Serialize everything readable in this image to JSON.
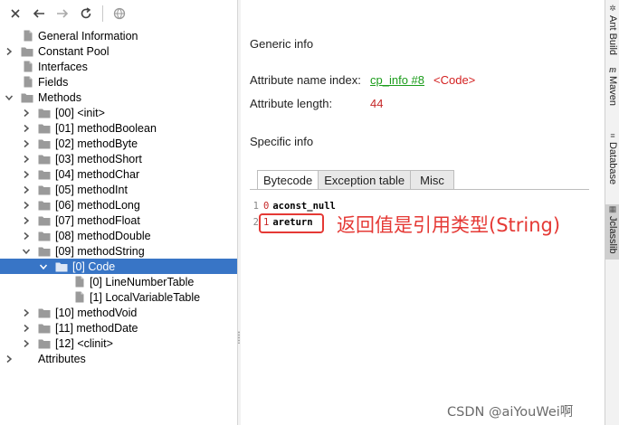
{
  "toolbar": {
    "buttons": [
      {
        "name": "close-icon",
        "glyph": "✕"
      },
      {
        "name": "back-icon",
        "glyph": "←"
      },
      {
        "name": "forward-icon",
        "glyph": "→"
      },
      {
        "name": "refresh-icon",
        "glyph": "↻"
      },
      {
        "name": "browser-icon",
        "glyph": "◍"
      }
    ]
  },
  "tree": {
    "items": [
      {
        "label": "General Information",
        "type": "file"
      },
      {
        "label": "Constant Pool",
        "type": "folder",
        "state": "collapsed"
      },
      {
        "label": "Interfaces",
        "type": "file"
      },
      {
        "label": "Fields",
        "type": "file"
      },
      {
        "label": "Methods",
        "type": "folder",
        "state": "expanded"
      },
      {
        "label": "[00] <init>",
        "type": "folder",
        "state": "collapsed"
      },
      {
        "label": "[01] methodBoolean",
        "type": "folder",
        "state": "collapsed"
      },
      {
        "label": "[02] methodByte",
        "type": "folder",
        "state": "collapsed"
      },
      {
        "label": "[03] methodShort",
        "type": "folder",
        "state": "collapsed"
      },
      {
        "label": "[04] methodChar",
        "type": "folder",
        "state": "collapsed"
      },
      {
        "label": "[05] methodInt",
        "type": "folder",
        "state": "collapsed"
      },
      {
        "label": "[06] methodLong",
        "type": "folder",
        "state": "collapsed"
      },
      {
        "label": "[07] methodFloat",
        "type": "folder",
        "state": "collapsed"
      },
      {
        "label": "[08] methodDouble",
        "type": "folder",
        "state": "collapsed"
      },
      {
        "label": "[09] methodString",
        "type": "folder",
        "state": "expanded"
      },
      {
        "label": "[0] Code",
        "type": "folder",
        "state": "expanded",
        "selected": true
      },
      {
        "label": "[0] LineNumberTable",
        "type": "file"
      },
      {
        "label": "[1] LocalVariableTable",
        "type": "file"
      },
      {
        "label": "[10] methodVoid",
        "type": "folder",
        "state": "collapsed"
      },
      {
        "label": "[11] methodDate",
        "type": "folder",
        "state": "collapsed"
      },
      {
        "label": "[12] <clinit>",
        "type": "folder",
        "state": "collapsed"
      },
      {
        "label": "Attributes",
        "type": "none",
        "state": "collapsed"
      }
    ]
  },
  "content": {
    "generic_title": "Generic info",
    "name_index_label": "Attribute name index:",
    "name_index_link": "cp_info #8",
    "name_index_value": "<Code>",
    "length_label": "Attribute length:",
    "length_value": "44",
    "specific_title": "Specific info",
    "tabs": [
      "Bytecode",
      "Exception table",
      "Misc"
    ],
    "active_tab": "Bytecode",
    "code_lines": [
      {
        "line": "1",
        "offset": "0",
        "op": "aconst_null"
      },
      {
        "line": "2",
        "offset": "1",
        "op": "areturn"
      }
    ],
    "annotation": "返回值是引用类型(String)"
  },
  "side_tabs": [
    "Ant Build",
    "Maven",
    "Database",
    "Jclasslib"
  ],
  "watermark": "CSDN @aiYouWei啊",
  "colors": {
    "selection": "#3875c6",
    "link": "#1a9c1a",
    "code_tag": "#d32020",
    "annotation": "#e53935"
  }
}
